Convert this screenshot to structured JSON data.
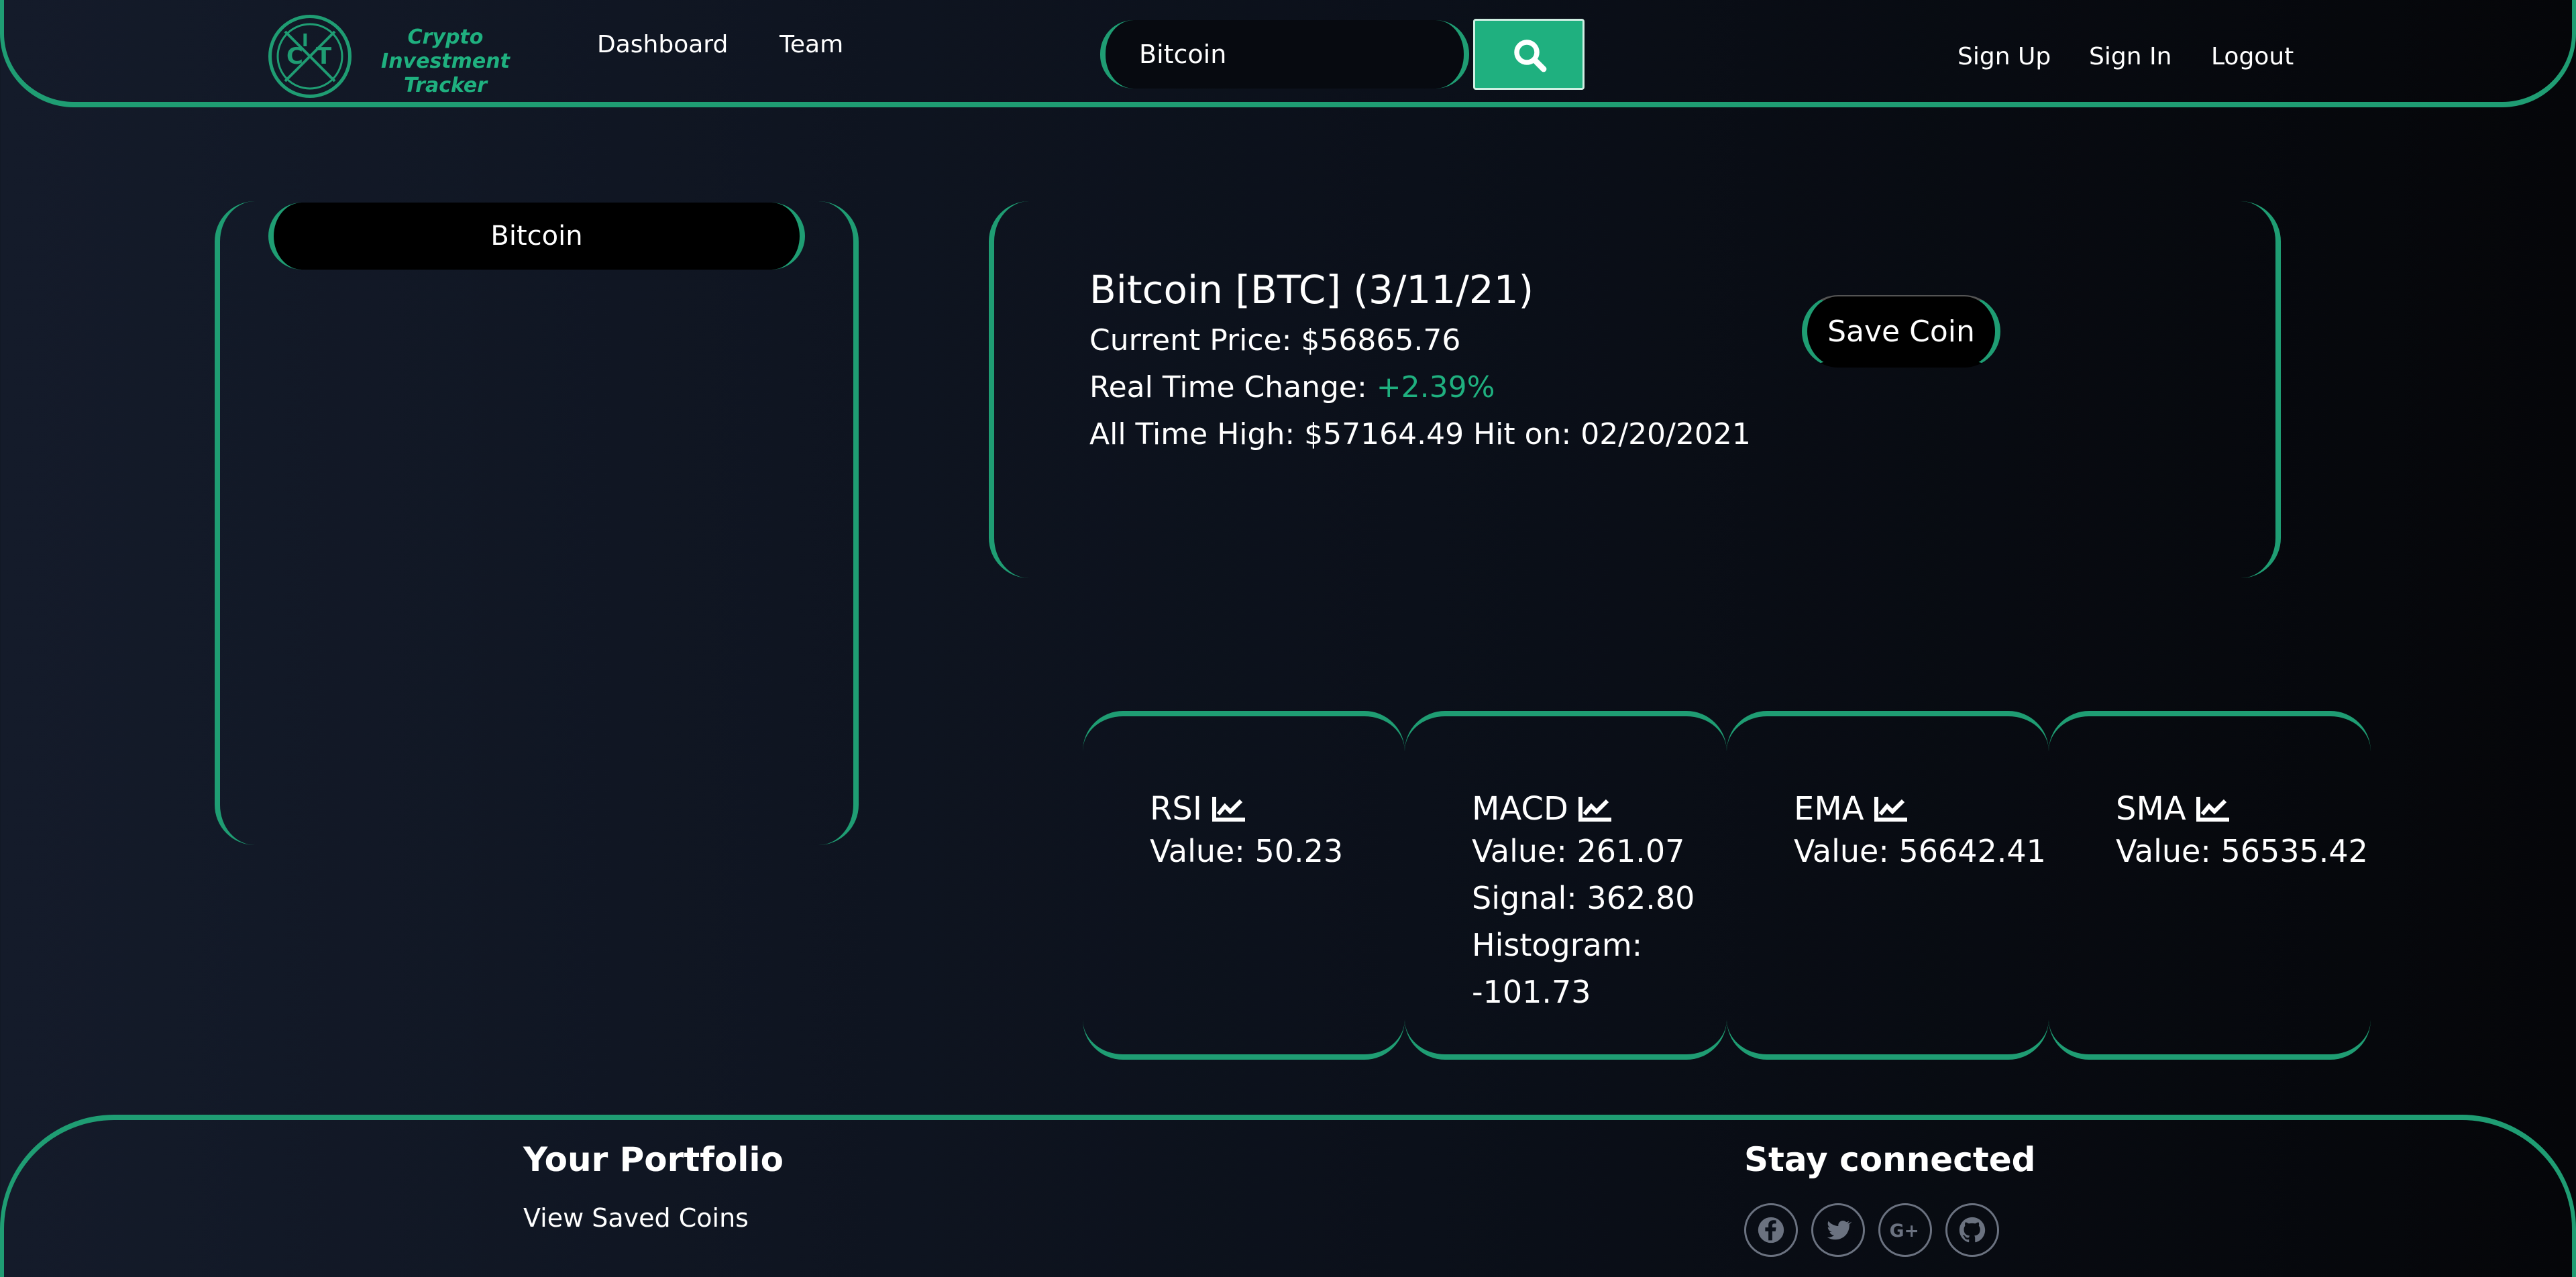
{
  "nav": {
    "logo_text": "Crypto Investment Tracker",
    "links": [
      "Dashboard",
      "Team"
    ],
    "search_value": "Bitcoin",
    "auth": [
      "Sign Up",
      "Sign In",
      "Logout"
    ]
  },
  "sidebar": {
    "selected_coin": "Bitcoin"
  },
  "coin": {
    "title": "Bitcoin [BTC] (3/11/21)",
    "current_price_label": "Current Price: ",
    "current_price": "$56865.76",
    "change_label": "Real Time Change: ",
    "change_value": "+2.39%",
    "ath_label": "All Time High: ",
    "ath_value": "$57164.49",
    "ath_hit_label": " Hit on: ",
    "ath_date": "02/20/2021",
    "save_label": "Save Coin"
  },
  "indicators": [
    {
      "name": "RSI",
      "lines": [
        "Value: 50.23"
      ]
    },
    {
      "name": "MACD",
      "lines": [
        "Value: 261.07",
        "Signal: 362.80",
        "Histogram:",
        "-101.73"
      ]
    },
    {
      "name": "EMA",
      "lines": [
        "Value: 56642.41"
      ]
    },
    {
      "name": "SMA",
      "lines": [
        "Value: 56535.42"
      ]
    }
  ],
  "footer": {
    "portfolio_heading": "Your Portfolio",
    "portfolio_link": "View Saved Coins",
    "connect_heading": "Stay connected",
    "social_icons": [
      "facebook-icon",
      "twitter-icon",
      "google-plus-icon",
      "github-icon"
    ]
  },
  "colors": {
    "accent": "#1f9d73",
    "positive": "#1fb07f",
    "background": "#0b101a"
  }
}
